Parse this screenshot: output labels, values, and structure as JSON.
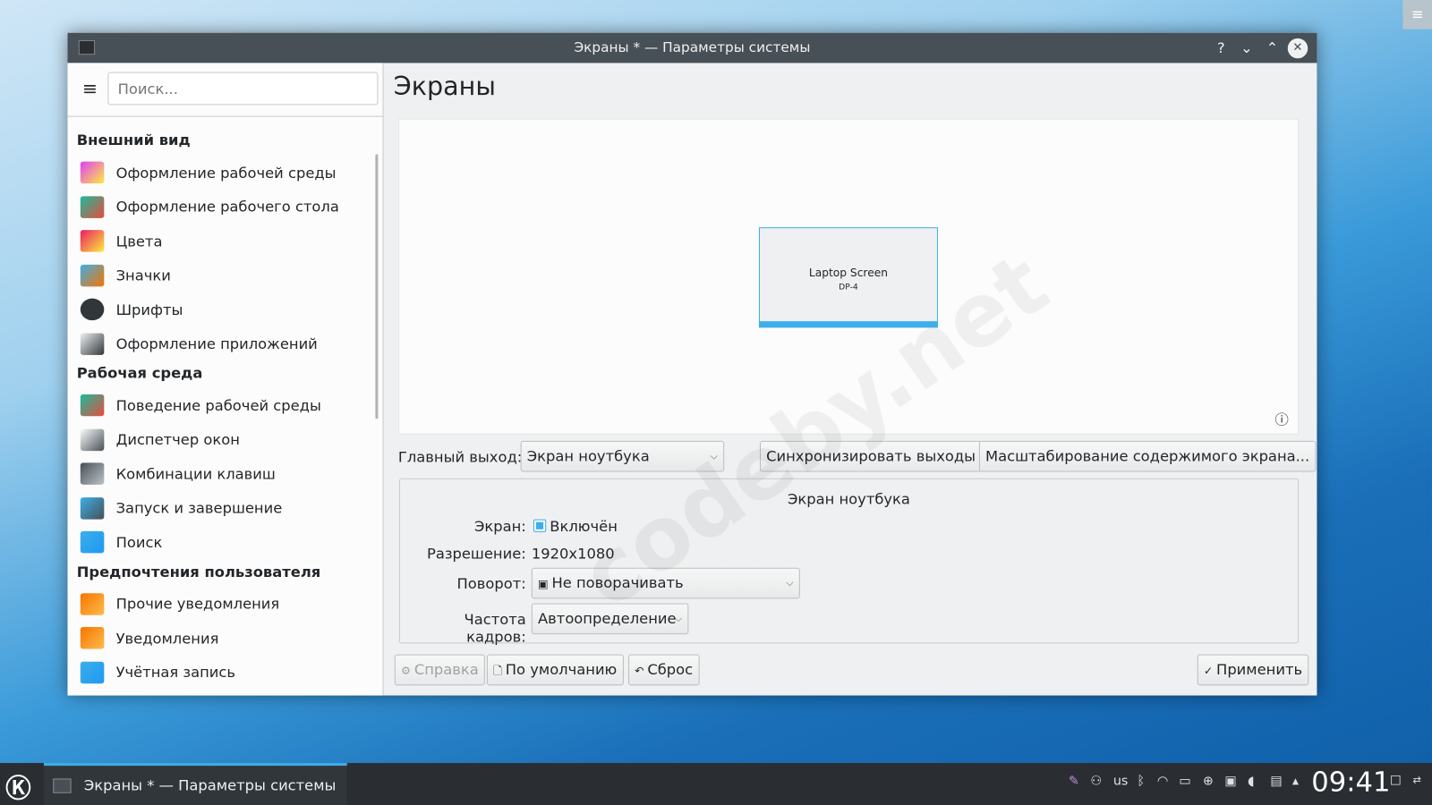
{
  "window": {
    "title": "Экраны * — Параметры системы",
    "help": "?",
    "minimize": "⌄",
    "maximize": "⌃",
    "close": "✕"
  },
  "sidebar": {
    "search_placeholder": "Поиск...",
    "menu_icon": "≡",
    "categories": [
      {
        "label": "Внешний вид",
        "items": [
          "Оформление рабочей среды",
          "Оформление рабочего стола",
          "Цвета",
          "Значки",
          "Шрифты",
          "Оформление приложений"
        ]
      },
      {
        "label": "Рабочая среда",
        "items": [
          "Поведение рабочей среды",
          "Диспетчер окон",
          "Комбинации клавиш",
          "Запуск и завершение",
          "Поиск"
        ]
      },
      {
        "label": "Предпочтения пользователя",
        "items": [
          "Прочие уведомления",
          "Уведомления",
          "Учётная запись"
        ]
      }
    ]
  },
  "main": {
    "title": "Экраны",
    "preview": {
      "screen_name": "Laptop Screen",
      "screen_output": "DP-4",
      "info": "ⓘ"
    },
    "primary_label": "Главный выход:",
    "primary_value": "Экран ноутбука",
    "sync_button": "Синхронизировать выходы",
    "scale_button": "Масштабирование содержимого экрана...",
    "group": {
      "title": "Экран ноутбука",
      "screen_label": "Экран:",
      "enabled_label": "Включён",
      "enabled": true,
      "resolution_label": "Разрешение:",
      "resolution_value": "1920x1080",
      "rotation_label": "Поворот:",
      "rotation_value": "Не поворачивать",
      "refresh_label": "Частота кадров:",
      "refresh_value": "Автоопределение"
    },
    "footer": {
      "help": "Справка",
      "defaults": "По умолчанию",
      "reset": "Сброс",
      "apply": "Применить"
    }
  },
  "watermark": "codeby.net",
  "taskbar": {
    "task_label": "Экраны * — Параметры системы",
    "keyboard_layout": "us",
    "clock": "09:41"
  },
  "colors": {
    "accent": "#3daee9",
    "titlebar": "#475057",
    "taskbar": "#2a2e32"
  }
}
